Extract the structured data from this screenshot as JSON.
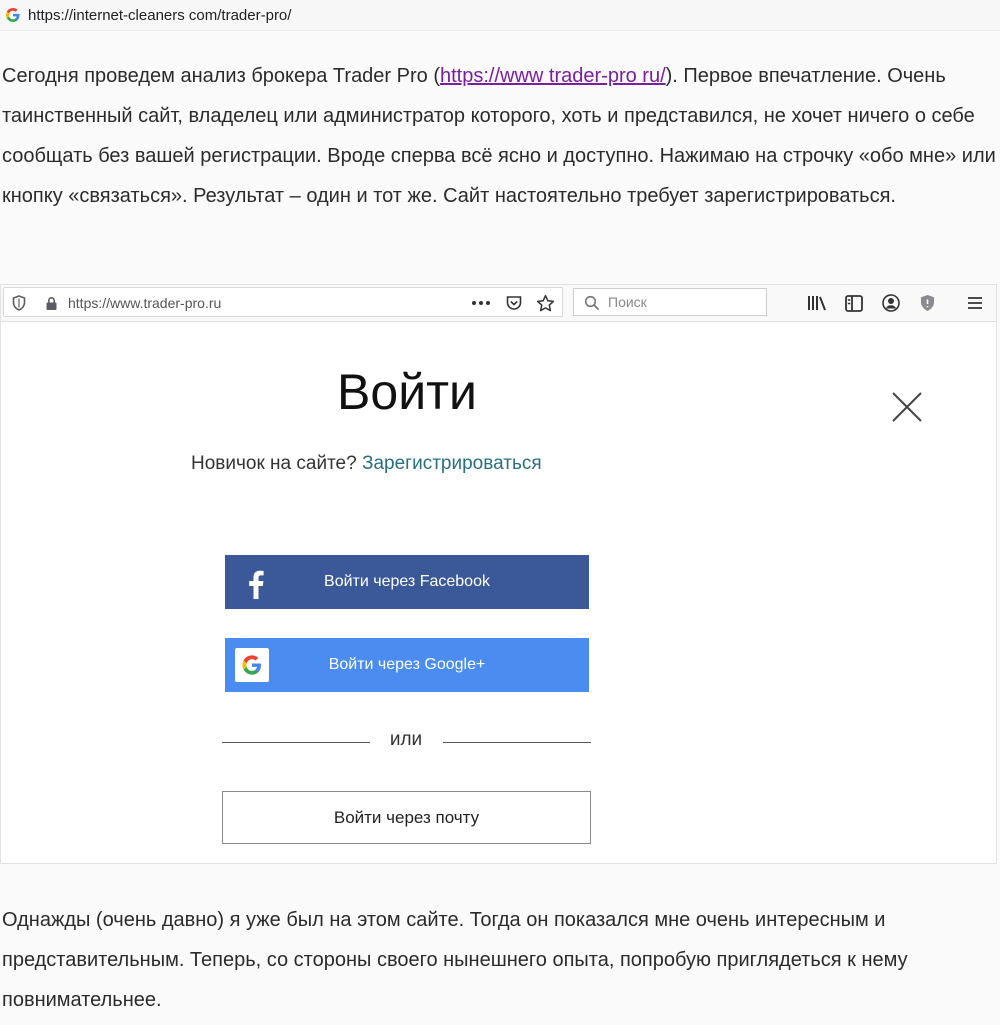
{
  "address_bar": {
    "url": "https://internet-cleaners com/trader-pro/"
  },
  "article": {
    "para1_before_link": "Сегодня проведем анализ брокера Trader Pro (",
    "para1_link": "https://www trader-pro ru/",
    "para1_after_link": "). Первое впечатление. Очень таинственный сайт, владелец или администратор которого, хоть и представился, не хочет ничего о себе сообщать без вашей регистрации. Вроде сперва всё ясно и доступно. Нажимаю на строчку «обо мне» или кнопку «связаться». Результат – один и тот же. Сайт настоятельно требует зарегистрироваться.",
    "para2": "Однажды (очень давно) я уже был на этом сайте. Тогда он показался мне очень интересным и представительным. Теперь, со стороны своего нынешнего опыта, попробую приглядеться к нему повнимательнее."
  },
  "embedded_browser": {
    "url": "https://www.trader-pro.ru",
    "search_placeholder": "Поиск"
  },
  "login": {
    "title": "Войти",
    "newbie_text": "Новичок на сайте?",
    "register_link": "Зарегистрироваться",
    "facebook_button": "Войти через Facebook",
    "google_button": "Войти через Google+",
    "divider": "или",
    "email_button": "Войти через почту"
  },
  "colors": {
    "facebook": "#3b5998",
    "google": "#4a8cf0",
    "link": "#7b1fa2",
    "register_link": "#2a6f82"
  }
}
